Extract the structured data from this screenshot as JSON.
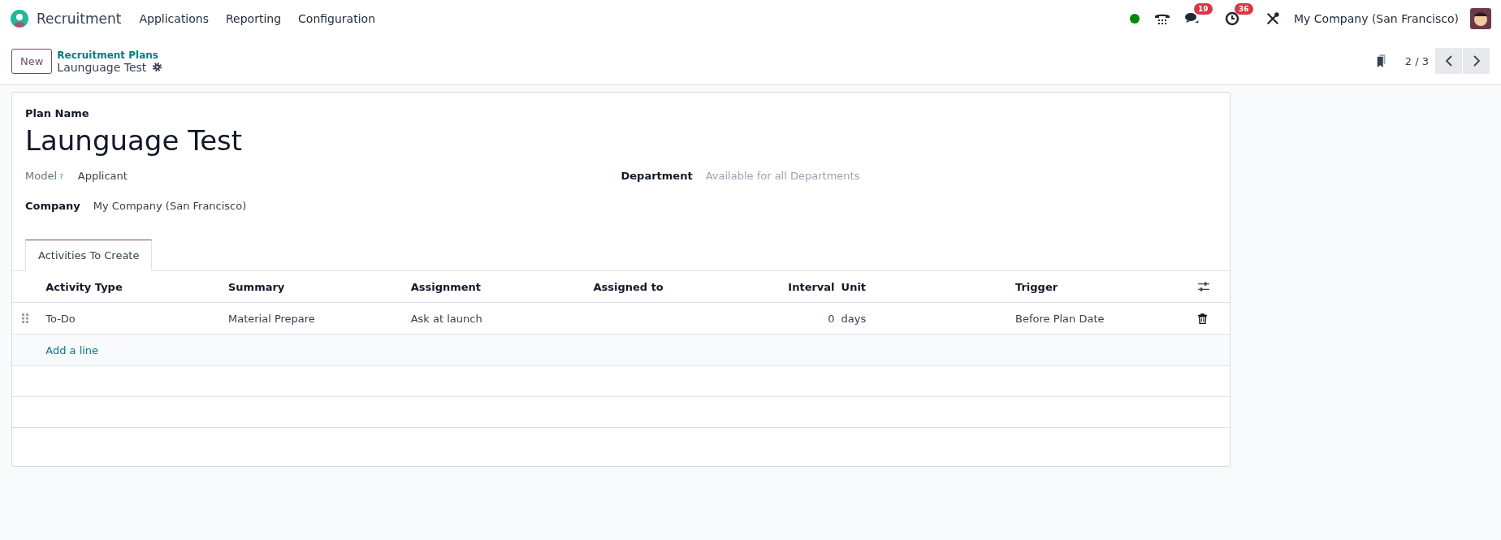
{
  "navbar": {
    "app_name": "Recruitment",
    "menu": [
      "Applications",
      "Reporting",
      "Configuration"
    ],
    "messages_badge": "19",
    "activities_badge": "36",
    "company": "My Company (San Francisco)"
  },
  "control_panel": {
    "new_button": "New",
    "breadcrumb": "Recruitment Plans",
    "record_name": "Launguage Test",
    "pager": "2 / 3"
  },
  "form": {
    "plan_name_label": "Plan Name",
    "plan_name": "Launguage Test",
    "model_label": "Model",
    "model_help": "?",
    "model": "Applicant",
    "department_label": "Department",
    "department_placeholder": "Available for all Departments",
    "company_label": "Company",
    "company": "My Company (San Francisco)"
  },
  "tabs": [
    {
      "label": "Activities To Create",
      "selected": true
    }
  ],
  "table": {
    "columns": [
      {
        "label": "Activity Type",
        "kind": "text"
      },
      {
        "label": "Summary",
        "kind": "text"
      },
      {
        "label": "Assignment",
        "kind": "text"
      },
      {
        "label": "Assigned to",
        "kind": "text"
      },
      {
        "label": "Interval",
        "kind": "number"
      },
      {
        "label": "Unit",
        "kind": "text"
      },
      {
        "label": "Trigger",
        "kind": "text"
      }
    ],
    "rows": [
      {
        "cells": [
          "To-Do",
          "Material Prepare",
          "Ask at launch",
          "",
          "0",
          "days",
          "Before Plan Date"
        ]
      }
    ],
    "add_line": "Add a line"
  }
}
